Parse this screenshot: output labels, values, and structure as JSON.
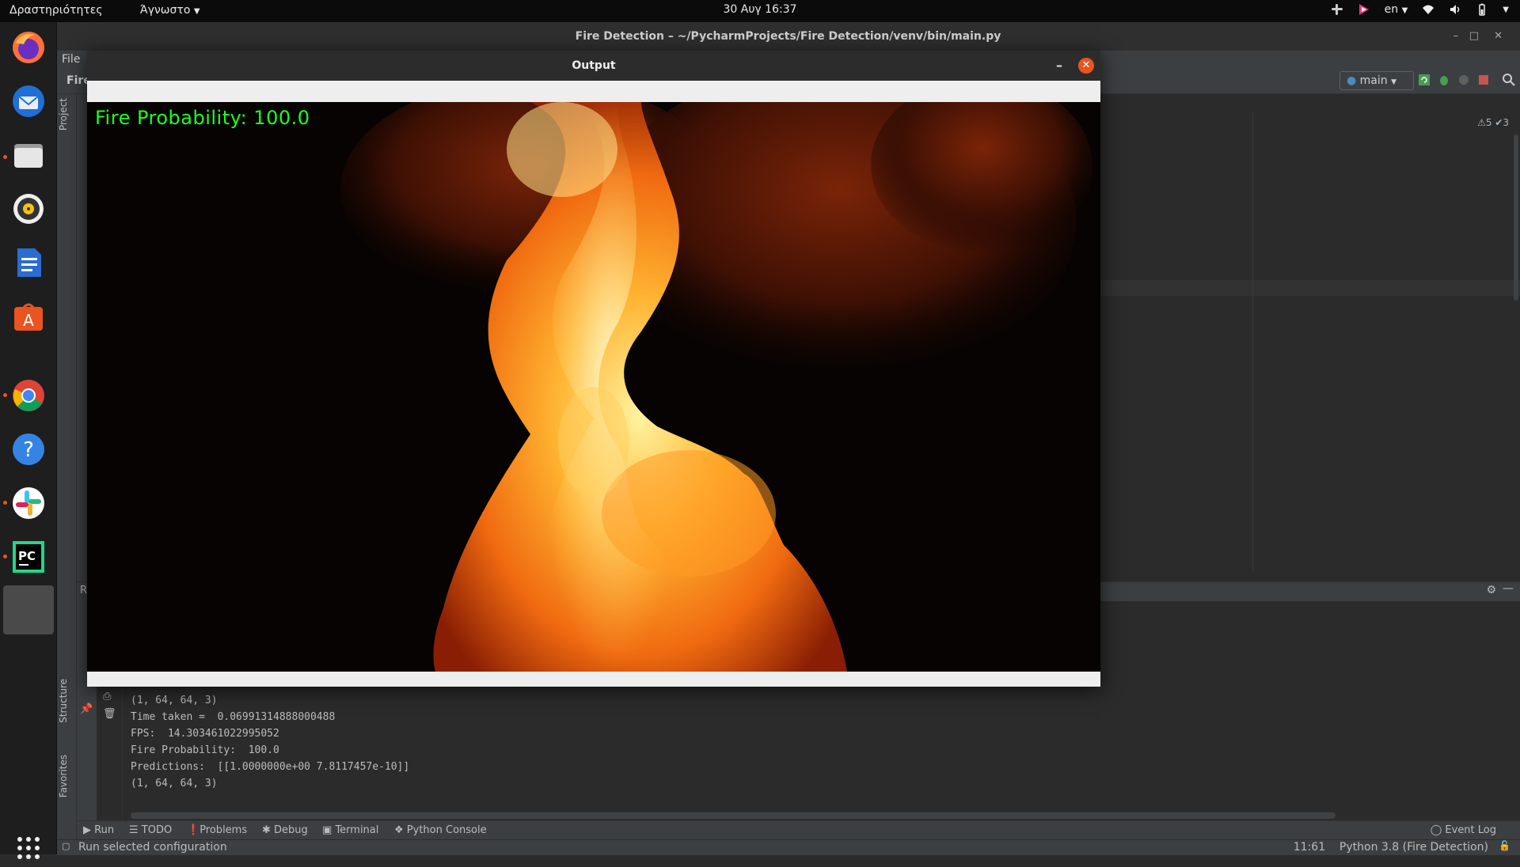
{
  "topbar": {
    "activities": "Δραστηριότητες",
    "app_menu": "Άγνωστο",
    "clock": "30 Αυγ  16:37",
    "lang": "en"
  },
  "dock": {
    "items": [
      {
        "name": "firefox-icon"
      },
      {
        "name": "thunderbird-icon"
      },
      {
        "name": "files-icon"
      },
      {
        "name": "rhythmbox-icon"
      },
      {
        "name": "libreoffice-writer-icon"
      },
      {
        "name": "software-center-icon"
      },
      {
        "name": "chrome-icon"
      },
      {
        "name": "help-icon"
      },
      {
        "name": "slack-icon"
      },
      {
        "name": "pycharm-icon",
        "label": "PC"
      },
      {
        "name": "active-window-icon"
      },
      {
        "name": "show-apps-icon"
      }
    ]
  },
  "ide": {
    "title": "Fire Detection – ~/PycharmProjects/Fire Detection/venv/bin/main.py",
    "menu_file": "File",
    "breadcrumb": "Fire",
    "run_config": "main",
    "inspections": "⚠5 ✔3",
    "project_tab": "Project",
    "structure_tab": "Structure",
    "favorites_tab": "Favorites",
    "run_header": "R"
  },
  "output_window": {
    "title": "Output",
    "overlay_text": "Fire Probability: 100.0"
  },
  "console": {
    "lines": [
      "(1, 64, 64, 3)",
      "Time taken =  0.06991314888000488",
      "FPS:  14.303461022995052",
      "Fire Probability:  100.0",
      "Predictions:  [[1.0000000e+00 7.8117457e-10]]",
      "(1, 64, 64, 3)"
    ]
  },
  "tool_tabs": {
    "run": "Run",
    "todo": "TODO",
    "problems": "Problems",
    "debug": "Debug",
    "terminal": "Terminal",
    "python_console": "Python Console",
    "event_log": "Event Log"
  },
  "status_bar": {
    "message": "Run selected configuration",
    "position": "11:61",
    "interpreter": "Python 3.8 (Fire Detection)"
  }
}
